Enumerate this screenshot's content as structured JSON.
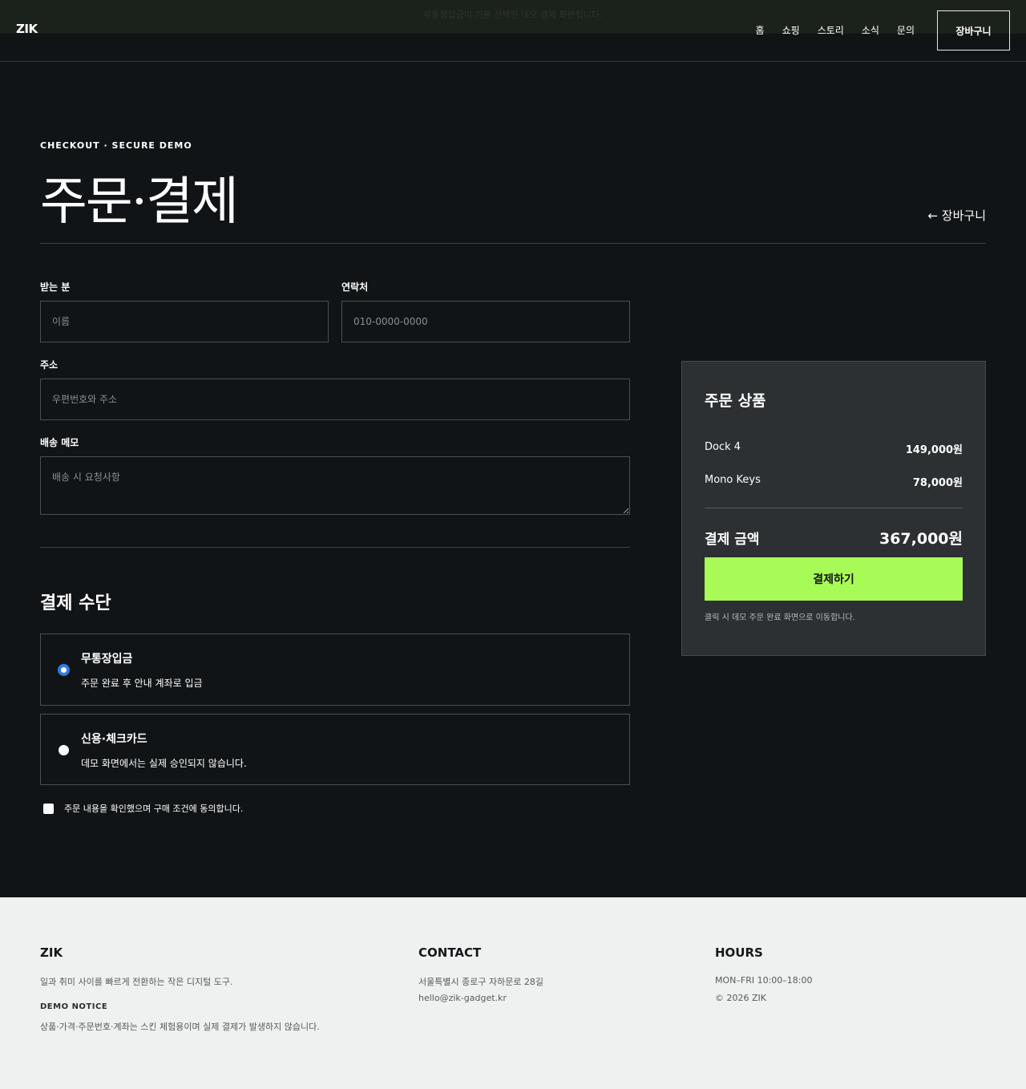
{
  "notice": "무통장입금이 기본 선택된 데모 결제 화면입니다.",
  "header": {
    "logo": "ZIK",
    "nav": [
      "홈",
      "쇼핑",
      "스토리",
      "소식",
      "문의"
    ],
    "cart": "장바구니"
  },
  "page": {
    "eyebrow": "CHECKOUT · SECURE DEMO",
    "title": "주문·결제",
    "back": "← 장바구니"
  },
  "form": {
    "name_label": "받는 분",
    "name_placeholder": "이름",
    "phone_label": "연락처",
    "phone_placeholder": "010-0000-0000",
    "address_label": "주소",
    "address_placeholder": "우편번호와 주소",
    "memo_label": "배송 메모",
    "memo_placeholder": "배송 시 요청사항"
  },
  "payment": {
    "title": "결제 수단",
    "options": [
      {
        "name": "무통장입금",
        "desc": "주문 완료 후 안내 계좌로 입금",
        "selected": true
      },
      {
        "name": "신용·체크카드",
        "desc": "데모 화면에서는 실제 승인되지 않습니다.",
        "selected": false
      }
    ],
    "agree": "주문 내용을 확인했으며 구매 조건에 동의합니다."
  },
  "summary": {
    "title": "주문 상품",
    "items": [
      {
        "name": "Dock 4",
        "price": "149,000원"
      },
      {
        "name": "Mono Keys",
        "price": "78,000원"
      }
    ],
    "total_label": "결제 금액",
    "total_value": "367,000원",
    "pay_button": "결제하기",
    "note": "클릭 시 데모 주문 완료 화면으로 이동합니다."
  },
  "footer": {
    "brand": "ZIK",
    "tagline": "일과 취미 사이를 빠르게 전환하는 작은 디지털 도구.",
    "notice_title": "DEMO NOTICE",
    "notice_text": "상품·가격·주문번호·계좌는 스킨 체험용이며 실제 결제가 발생하지 않습니다.",
    "contact_title": "CONTACT",
    "address": "서울특별시 종로구 자하문로 28길",
    "email": "hello@zik-gadget.kr",
    "hours_title": "HOURS",
    "hours": "MON–FRI 10:00–18:00",
    "copyright": "© 2026 ZIK"
  },
  "colors": {
    "background": "#111416",
    "accent": "#a8fb56",
    "panel": "#2c3032",
    "footer": "#eff1f0"
  }
}
